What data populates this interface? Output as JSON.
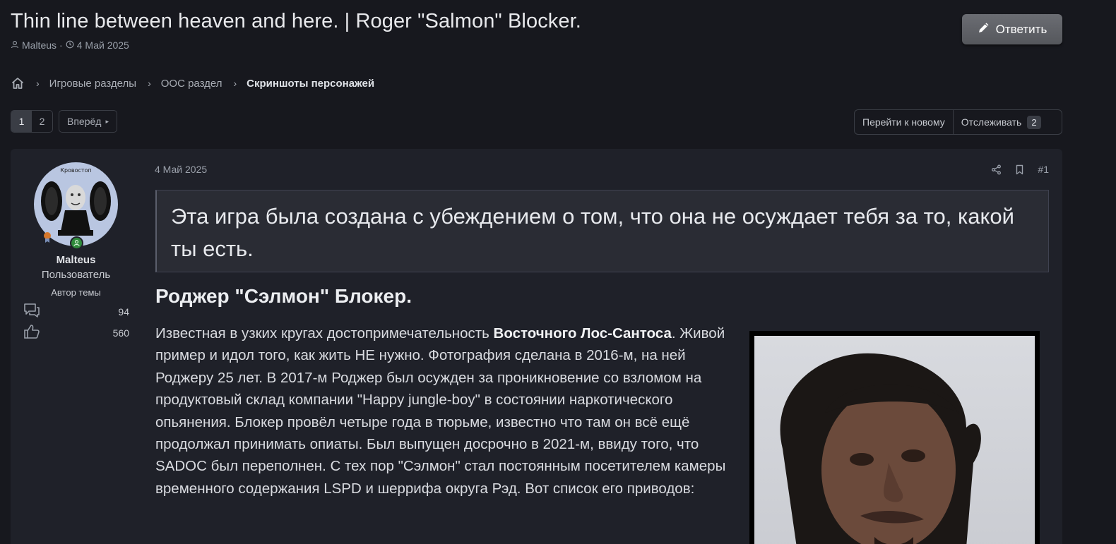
{
  "thread": {
    "title": "Thin line between heaven and here. | Roger \"Salmon\" Blocker.",
    "author": "Malteus",
    "date": "4 Май 2025",
    "reply_label": "Ответить"
  },
  "breadcrumb": {
    "home_icon": "home-icon",
    "items": [
      "Игровые разделы",
      "ООС раздел",
      "Скриншоты персонажей"
    ]
  },
  "pager": {
    "pages": [
      "1",
      "2"
    ],
    "current": "1",
    "next_label": "Вперёд"
  },
  "actions": {
    "go_new_label": "Перейти к новому",
    "watch_label": "Отслеживать",
    "watch_count": "2"
  },
  "post": {
    "user": {
      "avatar_caption": "Кровостоп",
      "name": "Malteus",
      "title": "Пользователь",
      "tag": "Автор темы",
      "messages": "94",
      "reactions": "560"
    },
    "date": "4 Май 2025",
    "number": "#1",
    "quote": "Эта игра была создана с убеждением о том, что она не осуждает тебя за то, какой ты есть.",
    "heading": "Роджер \"Сэлмон\" Блокер.",
    "body": {
      "intro": "Известная в узких кругах достопримечательность ",
      "bold": "Восточного Лос-Сантоса",
      "rest": ". Живой пример и идол того, как жить НЕ нужно. Фотография сделана в 2016-м, на ней Роджеру 25 лет. В 2017-м Роджер был осужден за проникновение со взломом на продуктовый склад компании \"Happy jungle-boy\" в состоянии наркотического опьянения. Блокер провёл четыре года в тюрьме, известно что там он всё ещё продолжал принимать опиаты. Был выпущен досрочно в 2021-м, ввиду того, что SADOC был переполнен. С тех пор \"Сэлмон\" стал постоянным посетителем камеры временного содержания LSPD и шеррифа округа Рэд. Вот список его приводов:"
    }
  },
  "colors": {
    "background": "#17181e",
    "post_bg": "#1f2129",
    "reply_button": "#5f6166",
    "online_badge": "#2f8a3b"
  }
}
